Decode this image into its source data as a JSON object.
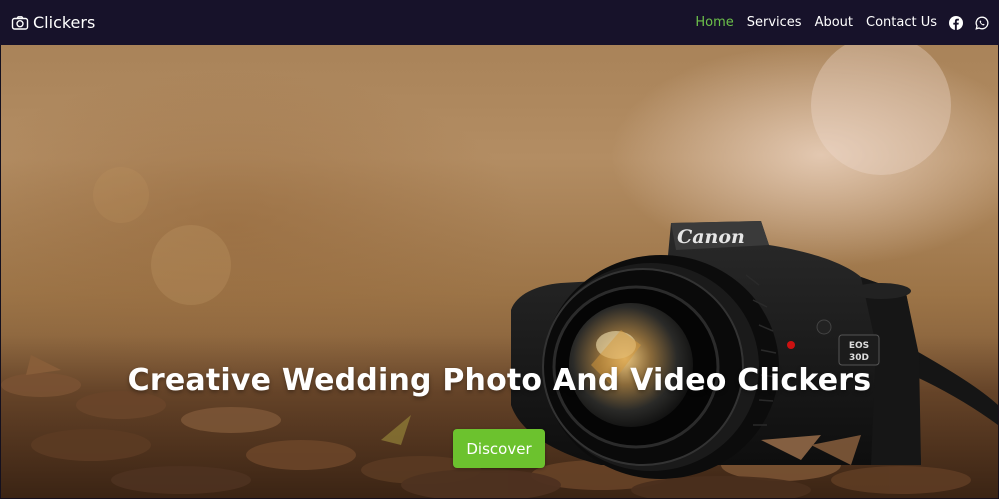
{
  "navbar": {
    "brand": "Clickers",
    "brand_icon": "camera-icon",
    "links": [
      {
        "label": "Home",
        "active": true
      },
      {
        "label": "Services",
        "active": false
      },
      {
        "label": "About",
        "active": false
      },
      {
        "label": "Contact Us",
        "active": false
      }
    ],
    "social": [
      "facebook-icon",
      "whatsapp-icon"
    ]
  },
  "hero": {
    "title": "Creative Wedding Photo And Video Clickers",
    "cta_label": "Discover",
    "camera_brand": "Canon",
    "camera_model": "EOS 30D"
  },
  "colors": {
    "navbar_bg": "#17122a",
    "active_link": "#6cc04a",
    "cta_bg": "#6cc22e",
    "text": "#ffffff"
  }
}
